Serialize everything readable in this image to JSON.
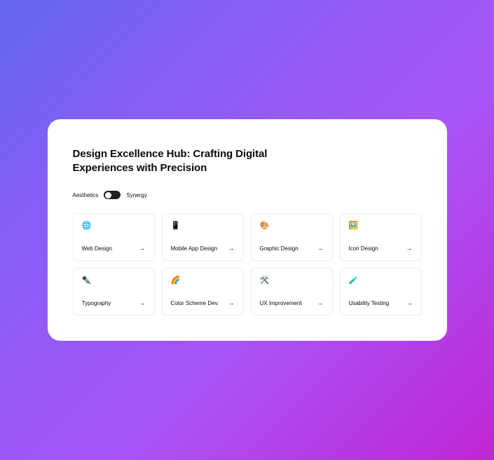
{
  "header": {
    "title": "Design Excellence Hub: Crafting Digital Experiences with Precision"
  },
  "toggle": {
    "left_label": "Aesthetics",
    "right_label": "Synergy",
    "position": "left"
  },
  "tiles": [
    {
      "icon": "🌐",
      "label": "Web Design"
    },
    {
      "icon": "📱",
      "label": "Mobile App Design"
    },
    {
      "icon": "🎨",
      "label": "Graphic Design"
    },
    {
      "icon": "🖼️",
      "label": "Icon Design"
    },
    {
      "icon": "✒️",
      "label": "Typography"
    },
    {
      "icon": "🌈",
      "label": "Color Scheme Dev."
    },
    {
      "icon": "🛠️",
      "label": "UX Improvement"
    },
    {
      "icon": "🧪",
      "label": "Usability Testing"
    }
  ]
}
